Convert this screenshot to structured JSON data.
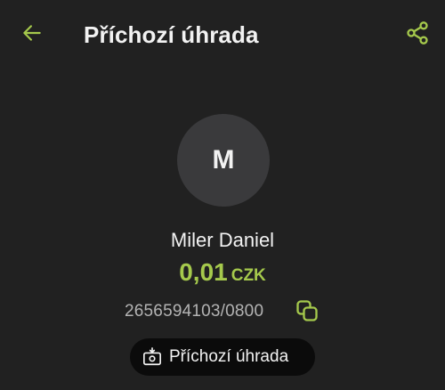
{
  "header": {
    "title": "Příchozí úhrada",
    "back_icon": "arrow-left-icon",
    "share_icon": "share-icon"
  },
  "counterparty": {
    "avatar_initial": "M",
    "name": "Miler Daniel",
    "account": "2656594103/0800",
    "copy_icon": "copy-icon"
  },
  "amount": {
    "value": "0,01",
    "currency": "CZK"
  },
  "type_badge": {
    "label": "Příchozí úhrada",
    "icon": "incoming-payment-icon"
  },
  "colors": {
    "background": "#212121",
    "accent": "#a5c94c",
    "avatar_bg": "#3a3a3c",
    "badge_bg": "#0b0b0b"
  }
}
